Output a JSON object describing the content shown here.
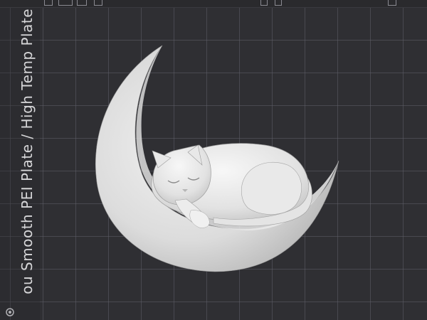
{
  "plate": {
    "label": "Smooth PEI Plate / High Temp Plate",
    "label_prefix_partial": "ou"
  },
  "model": {
    "subject": "sleeping-cat-on-crescent-moon",
    "color": "#e6e6e6"
  },
  "viewport": {
    "background": "#2f2f33",
    "grid_color": "#5f5f68"
  },
  "toolbar": {
    "icons": [
      "layout-icon",
      "grid-icon",
      "plate-icon",
      "settings-icon",
      "lock-icon",
      "plate-settings-icon",
      "expand-icon"
    ]
  },
  "corner": {
    "icon": "bambu-icon"
  }
}
